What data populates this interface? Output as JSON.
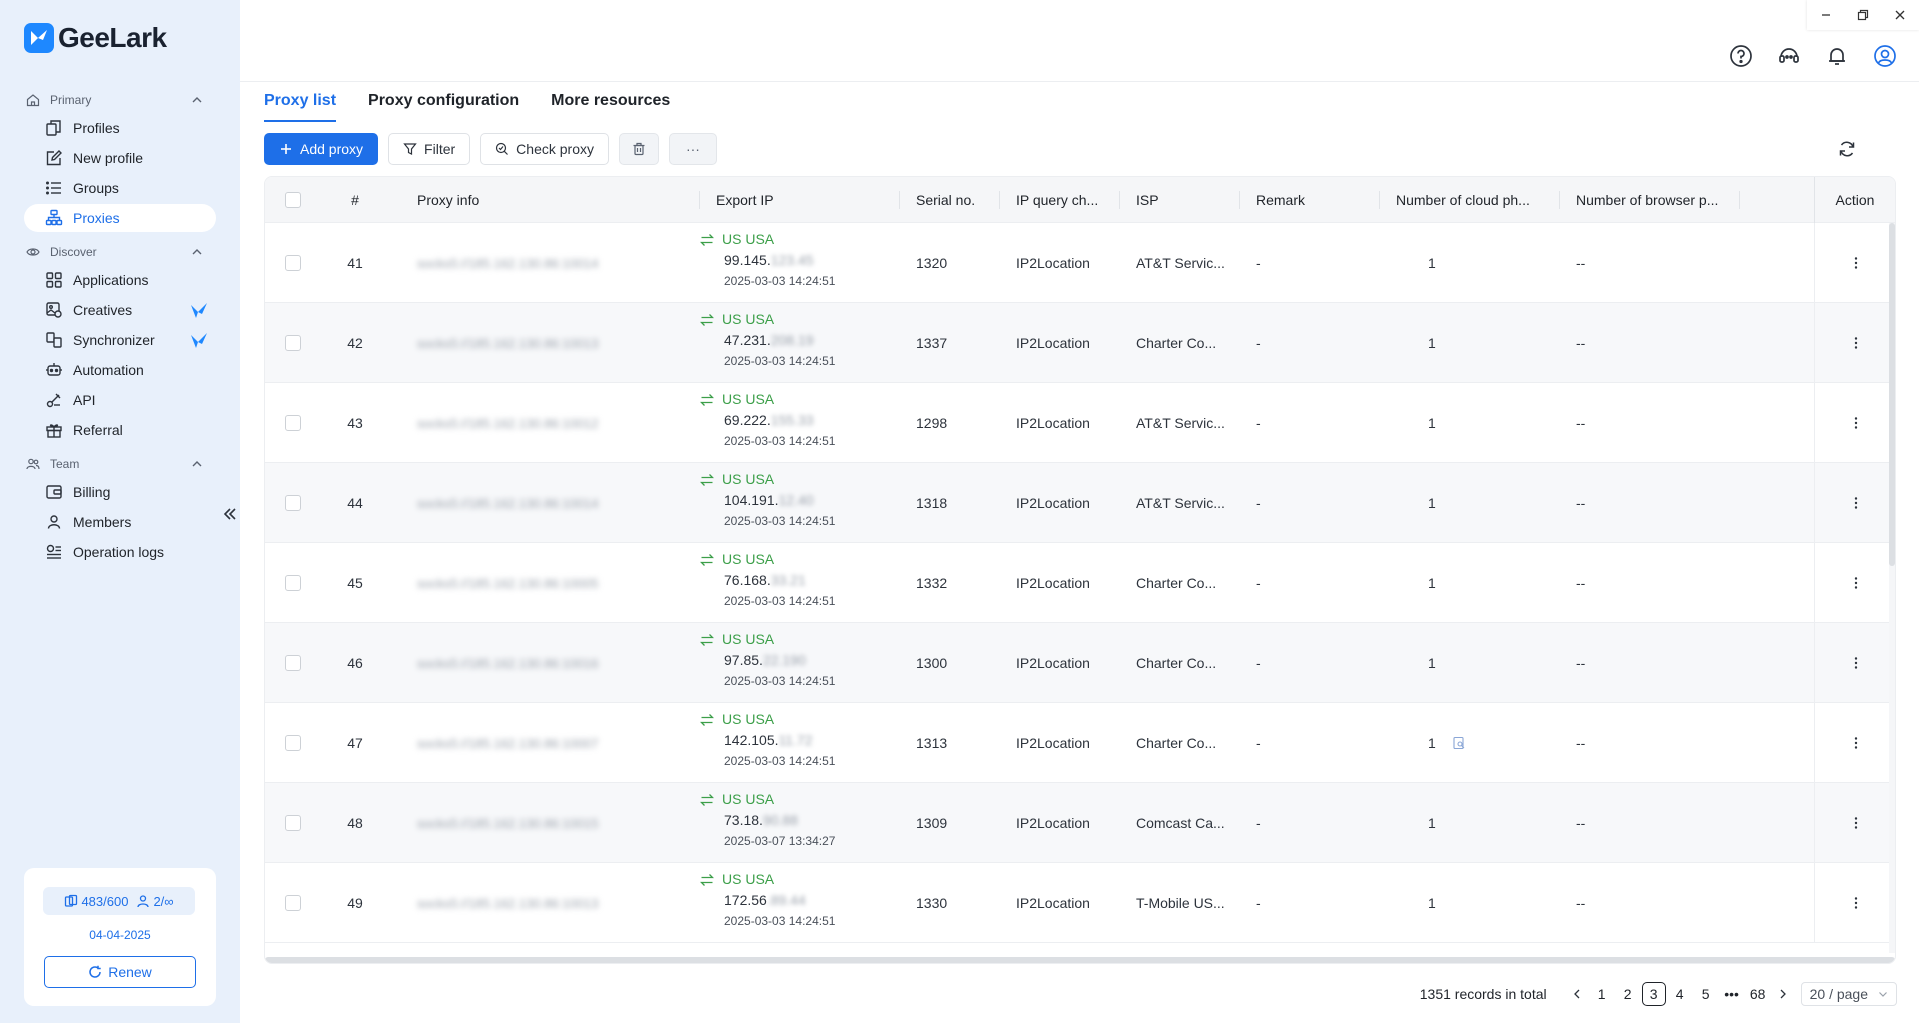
{
  "app": {
    "name": "GeeLark",
    "brand_color": "#1e88ff",
    "accent": "#1e6fe8"
  },
  "sidebar": {
    "sections": [
      {
        "label": "Primary",
        "icon": "home-icon",
        "items": [
          {
            "label": "Profiles",
            "icon": "profiles-icon"
          },
          {
            "label": "New profile",
            "icon": "edit-icon"
          },
          {
            "label": "Groups",
            "icon": "list-icon"
          },
          {
            "label": "Proxies",
            "icon": "proxies-icon",
            "active": true
          }
        ]
      },
      {
        "label": "Discover",
        "icon": "eye-icon",
        "items": [
          {
            "label": "Applications",
            "icon": "grid-icon"
          },
          {
            "label": "Creatives",
            "icon": "creatives-icon",
            "badge": "bird-icon"
          },
          {
            "label": "Synchronizer",
            "icon": "sync-icon",
            "badge": "bird-icon"
          },
          {
            "label": "Automation",
            "icon": "robot-icon"
          },
          {
            "label": "API",
            "icon": "api-icon"
          },
          {
            "label": "Referral",
            "icon": "gift-icon"
          }
        ]
      },
      {
        "label": "Team",
        "icon": "team-icon",
        "items": [
          {
            "label": "Billing",
            "icon": "wallet-icon"
          },
          {
            "label": "Members",
            "icon": "user-icon"
          },
          {
            "label": "Operation logs",
            "icon": "logs-icon"
          }
        ]
      }
    ],
    "plan": {
      "profiles": "483/600",
      "members": "2/∞",
      "date": "04-04-2025",
      "renew_label": "Renew"
    }
  },
  "tabs": [
    {
      "label": "Proxy list",
      "active": true
    },
    {
      "label": "Proxy configuration"
    },
    {
      "label": "More resources"
    }
  ],
  "toolbar": {
    "add_label": "Add proxy",
    "filter_label": "Filter",
    "check_label": "Check proxy",
    "more_label": "···"
  },
  "table": {
    "columns": [
      "#",
      "Proxy info",
      "Export IP",
      "Serial no.",
      "IP query ch...",
      "ISP",
      "Remark",
      "Number of cloud ph...",
      "Number of browser p...",
      "Action"
    ],
    "rows": [
      {
        "num": "41",
        "proxy": "socks5://185.162.130.86:10014",
        "country": "US USA",
        "ip": "99.145.",
        "ip_hidden": "123.45",
        "time": "2025-03-03 14:24:51",
        "serial": "1320",
        "query": "IP2Location",
        "isp": "AT&T Servic...",
        "remark": "-",
        "cloud": "1",
        "browser": "--"
      },
      {
        "num": "42",
        "proxy": "socks5://185.162.130.86:10013",
        "country": "US USA",
        "ip": "47.231.",
        "ip_hidden": "208.19",
        "time": "2025-03-03 14:24:51",
        "serial": "1337",
        "query": "IP2Location",
        "isp": "Charter Co...",
        "remark": "-",
        "cloud": "1",
        "browser": "--"
      },
      {
        "num": "43",
        "proxy": "socks5://185.162.130.86:10012",
        "country": "US USA",
        "ip": "69.222.",
        "ip_hidden": "155.33",
        "time": "2025-03-03 14:24:51",
        "serial": "1298",
        "query": "IP2Location",
        "isp": "AT&T Servic...",
        "remark": "-",
        "cloud": "1",
        "browser": "--"
      },
      {
        "num": "44",
        "proxy": "socks5://185.162.130.86:10014",
        "country": "US USA",
        "ip": "104.191.",
        "ip_hidden": "12.40",
        "time": "2025-03-03 14:24:51",
        "serial": "1318",
        "query": "IP2Location",
        "isp": "AT&T Servic...",
        "remark": "-",
        "cloud": "1",
        "browser": "--"
      },
      {
        "num": "45",
        "proxy": "socks5://185.162.130.86:10005",
        "country": "US USA",
        "ip": "76.168.",
        "ip_hidden": "33.21",
        "time": "2025-03-03 14:24:51",
        "serial": "1332",
        "query": "IP2Location",
        "isp": "Charter Co...",
        "remark": "-",
        "cloud": "1",
        "browser": "--"
      },
      {
        "num": "46",
        "proxy": "socks5://185.162.130.86:10016",
        "country": "US USA",
        "ip": "97.85.",
        "ip_hidden": "22.190",
        "time": "2025-03-03 14:24:51",
        "serial": "1300",
        "query": "IP2Location",
        "isp": "Charter Co...",
        "remark": "-",
        "cloud": "1",
        "browser": "--"
      },
      {
        "num": "47",
        "proxy": "socks5://185.162.130.86:10007",
        "country": "US USA",
        "ip": "142.105.",
        "ip_hidden": "11.72",
        "time": "2025-03-03 14:24:51",
        "serial": "1313",
        "query": "IP2Location",
        "isp": "Charter Co...",
        "remark": "-",
        "cloud": "1",
        "browser": "--",
        "cloud_icon": true
      },
      {
        "num": "48",
        "proxy": "socks5://185.162.130.86:10015",
        "country": "US USA",
        "ip": "73.18.",
        "ip_hidden": "90.88",
        "time": "2025-03-07 13:34:27",
        "serial": "1309",
        "query": "IP2Location",
        "isp": "Comcast Ca...",
        "remark": "-",
        "cloud": "1",
        "browser": "--"
      },
      {
        "num": "49",
        "proxy": "socks5://185.162.130.86:10013",
        "country": "US USA",
        "ip": "172.56",
        "ip_hidden": ".89.44",
        "time": "2025-03-03 14:24:51",
        "serial": "1330",
        "query": "IP2Location",
        "isp": "T-Mobile US...",
        "remark": "-",
        "cloud": "1",
        "browser": "--"
      }
    ]
  },
  "pagination": {
    "total": "1351 records in total",
    "pages": [
      "1",
      "2",
      "3",
      "4",
      "5",
      "•••",
      "68"
    ],
    "current": "3",
    "page_size": "20 / page"
  }
}
